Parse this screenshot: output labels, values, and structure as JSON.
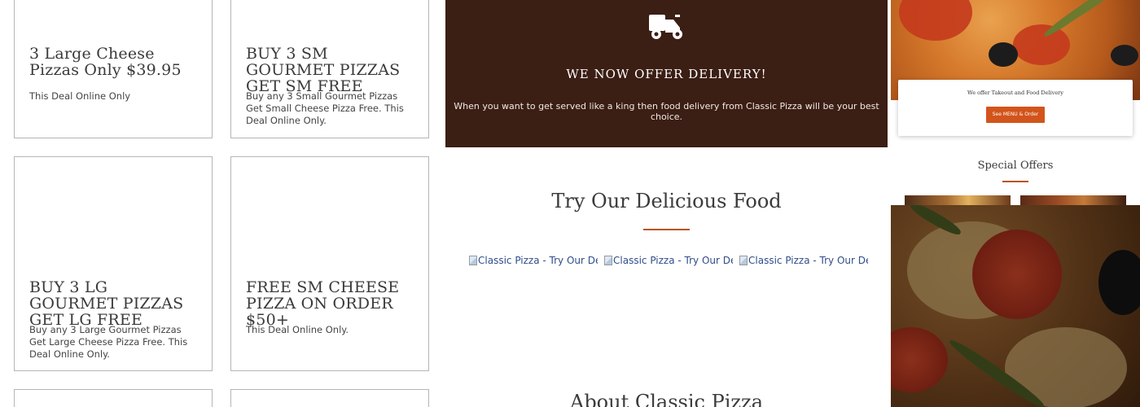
{
  "deals": [
    {
      "title": "3 Large Cheese Pizzas Only $39.95",
      "desc": "This Deal Online Only"
    },
    {
      "title": "BUY 3 SM GOURMET PIZZAS GET SM FREE",
      "desc": "Buy any 3 Small Gourmet Pizzas Get Small Cheese Pizza Free. This Deal Online Only."
    },
    {
      "title": "BUY 3 LG GOURMET PIZZAS GET LG FREE",
      "desc": "Buy any 3 Large Gourmet Pizzas Get Large Cheese Pizza Free. This Deal Online Only."
    },
    {
      "title": "FREE SM CHEESE PIZZA ON ORDER $50+",
      "desc": "This Deal Online Only."
    }
  ],
  "delivery": {
    "icon": "delivery-scooter-icon",
    "title": "WE NOW OFFER DELIVERY!",
    "text": "When you want to get served like a king then food delivery from Classic Pizza will be your best choice."
  },
  "try_food": {
    "title": "Try Our Delicious Food",
    "images": [
      "Classic Pizza - Try Our Delicious Food",
      "Classic Pizza - Try Our Delicious Food",
      "Classic Pizza - Try Our Delicious Food"
    ]
  },
  "about": {
    "title": "About Classic Pizza"
  },
  "sidebar": {
    "takeout_text": "We offer Takeout and Food Delivery",
    "takeout_button": "See MENU & Order",
    "special_title": "Special Offers"
  },
  "colors": {
    "accent": "#b8541d",
    "delivery_bg": "#3b1e14",
    "button": "#d2541b"
  }
}
